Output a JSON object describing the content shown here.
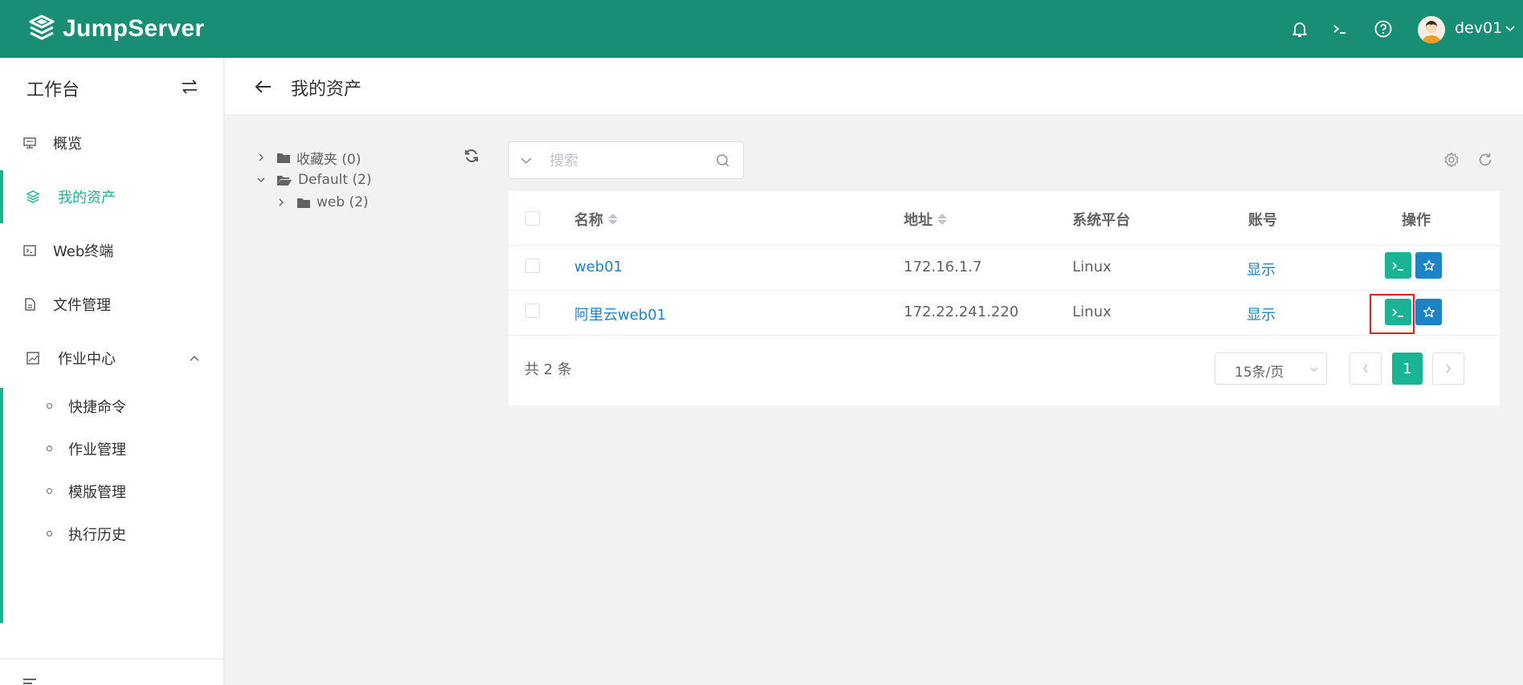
{
  "header": {
    "brand": "JumpServer",
    "username": "dev01"
  },
  "sidebar": {
    "title": "工作台",
    "items": [
      {
        "label": "概览"
      },
      {
        "label": "我的资产"
      },
      {
        "label": "Web终端"
      },
      {
        "label": "文件管理"
      },
      {
        "label": "作业中心"
      }
    ],
    "subitems": [
      {
        "label": "快捷命令"
      },
      {
        "label": "作业管理"
      },
      {
        "label": "模版管理"
      },
      {
        "label": "执行历史"
      }
    ]
  },
  "page": {
    "title": "我的资产"
  },
  "tree": {
    "nodes": [
      {
        "label": "收藏夹 (0)"
      },
      {
        "label": "Default (2)"
      },
      {
        "label": "web (2)"
      }
    ]
  },
  "search": {
    "placeholder": "搜索"
  },
  "table": {
    "columns": [
      "名称",
      "地址",
      "系统平台",
      "账号",
      "操作"
    ],
    "rows": [
      {
        "name": "web01",
        "address": "172.16.1.7",
        "platform": "Linux",
        "account": "显示"
      },
      {
        "name": "阿里云web01",
        "address": "172.22.241.220",
        "platform": "Linux",
        "account": "显示"
      }
    ]
  },
  "pagination": {
    "total": "共 2 条",
    "page_size": "15条/页",
    "current": "1"
  },
  "colors": {
    "header": "#188e74",
    "accent": "#1ab394",
    "link": "#1c84c6",
    "highlight_box": "#e02020"
  }
}
